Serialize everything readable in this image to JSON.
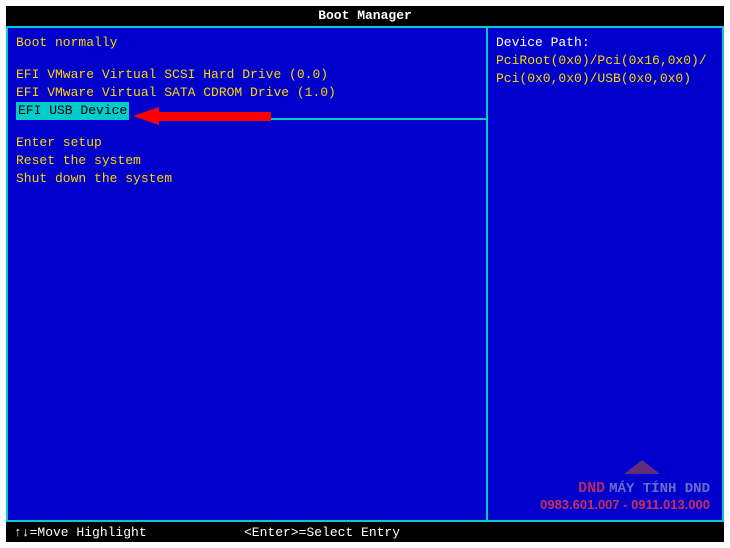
{
  "title": "Boot Manager",
  "left": {
    "group1": [
      {
        "label": "Boot normally",
        "selected": false
      }
    ],
    "group2": [
      {
        "label": "EFI VMware Virtual SCSI Hard Drive (0.0)",
        "selected": false
      },
      {
        "label": "EFI VMware Virtual SATA CDROM Drive (1.0)",
        "selected": false
      },
      {
        "label": "EFI USB Device",
        "selected": true
      }
    ],
    "group3": [
      {
        "label": "Enter setup",
        "selected": false
      },
      {
        "label": "Reset the system",
        "selected": false
      },
      {
        "label": "Shut down the system",
        "selected": false
      }
    ]
  },
  "right": {
    "heading": "Device Path:",
    "path": "PciRoot(0x0)/Pci(0x16,0x0)/Pci(0x0,0x0)/USB(0x0,0x0)"
  },
  "status": {
    "left": "↑↓=Move Highlight",
    "center": "<Enter>=Select Entry"
  },
  "watermark": {
    "brand_prefix": "DND",
    "brand": "MÁY TÍNH DND",
    "phone": "0983.601.007 - 0911.013.000"
  }
}
